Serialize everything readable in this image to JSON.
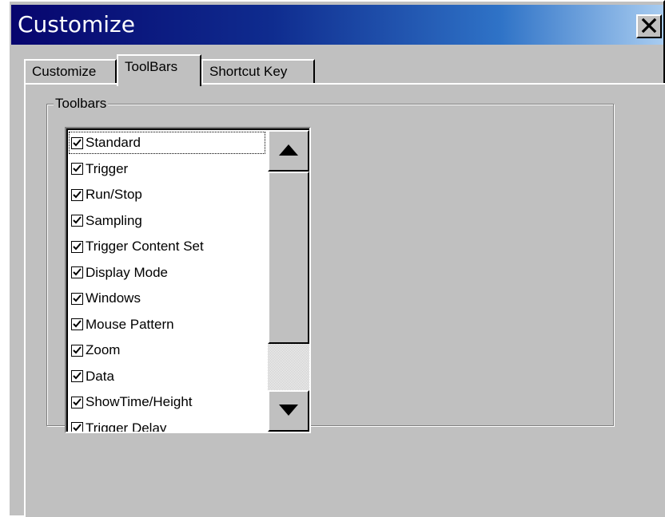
{
  "window": {
    "title": "Customize",
    "close_label": "✕"
  },
  "tabs": [
    {
      "label": "Customize",
      "active": false
    },
    {
      "label": "ToolBars",
      "active": true
    },
    {
      "label": "Shortcut Key",
      "active": false
    }
  ],
  "toolbars_group": {
    "label": "Toolbars",
    "items": [
      {
        "label": "Standard",
        "checked": true
      },
      {
        "label": "Trigger",
        "checked": true
      },
      {
        "label": "Run/Stop",
        "checked": true
      },
      {
        "label": "Sampling",
        "checked": true
      },
      {
        "label": "Trigger Content Set",
        "checked": true
      },
      {
        "label": "Display Mode",
        "checked": true
      },
      {
        "label": "Windows",
        "checked": true
      },
      {
        "label": "Mouse Pattern",
        "checked": true
      },
      {
        "label": "Zoom",
        "checked": true
      },
      {
        "label": "Data",
        "checked": true
      },
      {
        "label": "ShowTime/Height",
        "checked": true
      },
      {
        "label": "Trigger Delay",
        "checked": true
      }
    ],
    "scroll_position": 0.8
  },
  "colors": {
    "title_bar_start": "#07056e",
    "title_bar_end": "#a8ccf0",
    "window_face": "#c0c0c0"
  },
  "icons": {
    "close": "close-icon",
    "scroll_up": "arrow-up-icon",
    "scroll_down": "arrow-down-icon",
    "checkbox": "checkmark-icon"
  }
}
